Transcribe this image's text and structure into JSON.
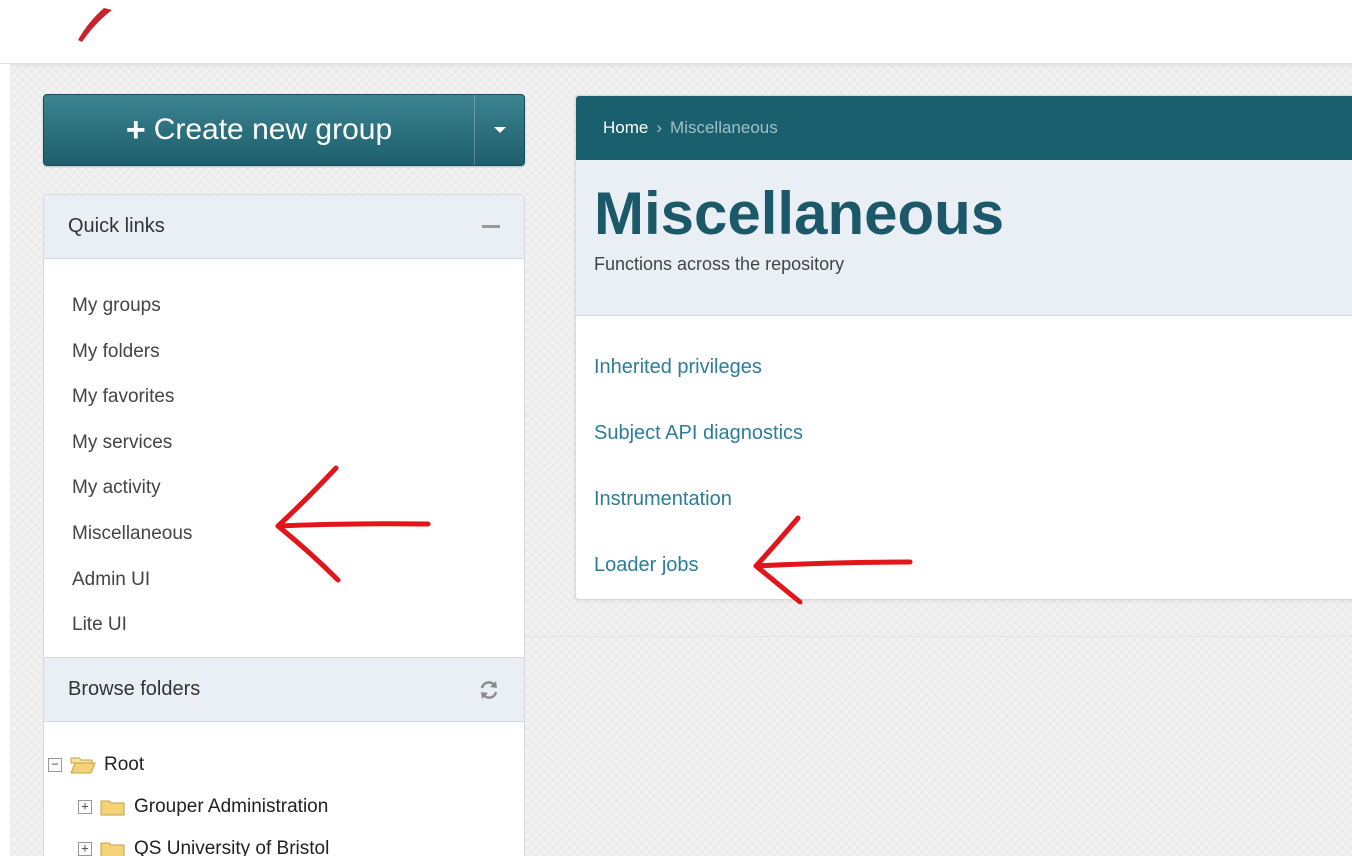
{
  "create_button": {
    "label": "Create new group",
    "plus": "+"
  },
  "quick_links": {
    "title": "Quick links",
    "items": [
      "My groups",
      "My folders",
      "My favorites",
      "My services",
      "My activity",
      "Miscellaneous",
      "Admin UI",
      "Lite UI"
    ]
  },
  "browse_folders": {
    "title": "Browse folders",
    "tree": [
      {
        "label": "Root",
        "toggle": "−",
        "level": 0
      },
      {
        "label": "Grouper Administration",
        "toggle": "+",
        "level": 1
      },
      {
        "label": "QS University of Bristol",
        "toggle": "+",
        "level": 1
      }
    ]
  },
  "breadcrumb": {
    "home": "Home",
    "separator": "›",
    "current": "Miscellaneous"
  },
  "page": {
    "title": "Miscellaneous",
    "subtitle": "Functions across the repository",
    "links": [
      "Inherited privileges",
      "Subject API diagnostics",
      "Instrumentation",
      "Loader jobs"
    ]
  },
  "colors": {
    "brand_teal": "#1a5f6e",
    "link_blue": "#2c7d9a",
    "annotation_red": "#e3151b",
    "folder_yellow": "#f3d27a"
  }
}
